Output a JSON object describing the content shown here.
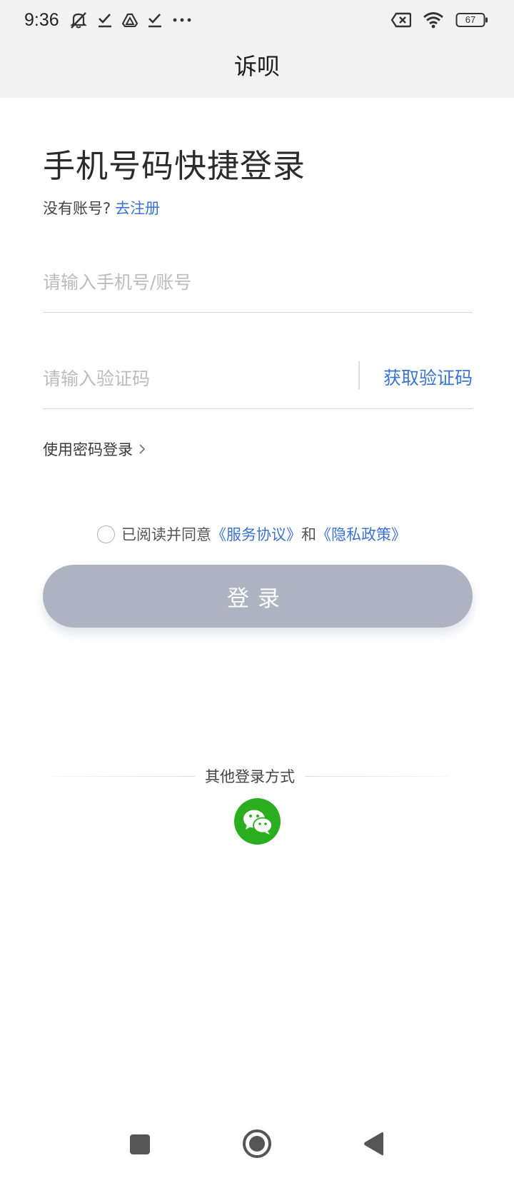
{
  "status_bar": {
    "time": "9:36",
    "left_icons": [
      "bell-off-icon",
      "check-download-icon",
      "drive-icon",
      "check-download-icon",
      "more-dots-icon"
    ],
    "right_icons": [
      "sim-off-icon",
      "wifi-icon",
      "battery-icon"
    ],
    "battery": "67"
  },
  "header": {
    "title": "诉呗"
  },
  "login": {
    "heading": "手机号码快捷登录",
    "register_prompt": "没有账号?",
    "register_link": "去注册",
    "phone_placeholder": "请输入手机号/账号",
    "code_placeholder": "请输入验证码",
    "get_code": "获取验证码",
    "password_login": "使用密码登录",
    "agreement_text": "已阅读并同意",
    "agreement_service": "《服务协议》",
    "agreement_and": "和",
    "agreement_privacy": "《隐私政策》",
    "login_button": "登录"
  },
  "other": {
    "label": "其他登录方式",
    "methods": [
      "wechat-icon"
    ]
  },
  "nav": [
    "recents-square-icon",
    "home-circle-icon",
    "back-triangle-icon"
  ],
  "colors": {
    "accent": "#3a73d0",
    "button_disabled": "#adb3c0",
    "wechat": "#2aae1f",
    "header_bg": "#f2f2f2"
  }
}
